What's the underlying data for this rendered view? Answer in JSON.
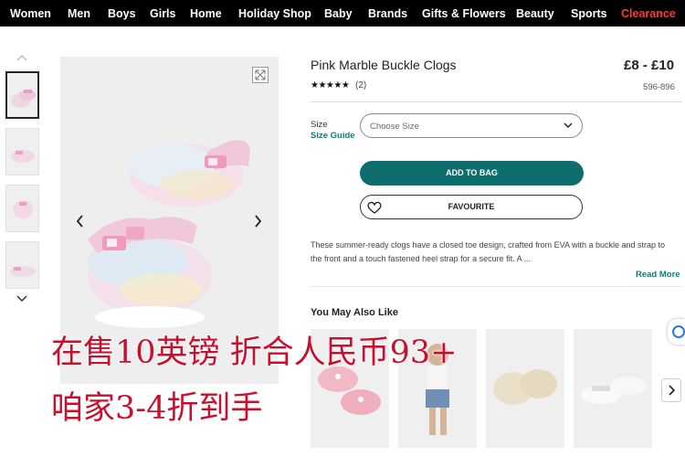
{
  "nav": {
    "items": [
      "Women",
      "Men",
      "Boys",
      "Girls",
      "Home",
      "Holiday Shop",
      "Baby",
      "Brands",
      "Gifts & Flowers",
      "Beauty",
      "Sports"
    ],
    "clearance": "Clearance"
  },
  "product": {
    "title": "Pink Marble Buckle Clogs",
    "price": "£8 - £10",
    "stars": "★★★★★",
    "reviews": "(2)",
    "code": "596-896",
    "rating": 5
  },
  "size": {
    "label": "Size",
    "guide": "Size Guide",
    "placeholder": "Choose Size"
  },
  "buttons": {
    "add": "ADD TO BAG",
    "favourite": "FAVOURITE"
  },
  "description": {
    "text": "These summer-ready clogs have a closed toe design, crafted from EVA with a buckle and strap to the front and a touch fastened heel strap for a secure fit. A ...",
    "read_more": "Read More"
  },
  "recommendations": {
    "title": "You May Also Like"
  },
  "overlay": {
    "line1": "在售10英镑 折合人民币93+",
    "line2": "咱家3-4折到手"
  },
  "colors": {
    "accent_teal": "#0e6d6d",
    "clearance_red": "#ff3b2f",
    "overlay_red": "#c8102e"
  }
}
